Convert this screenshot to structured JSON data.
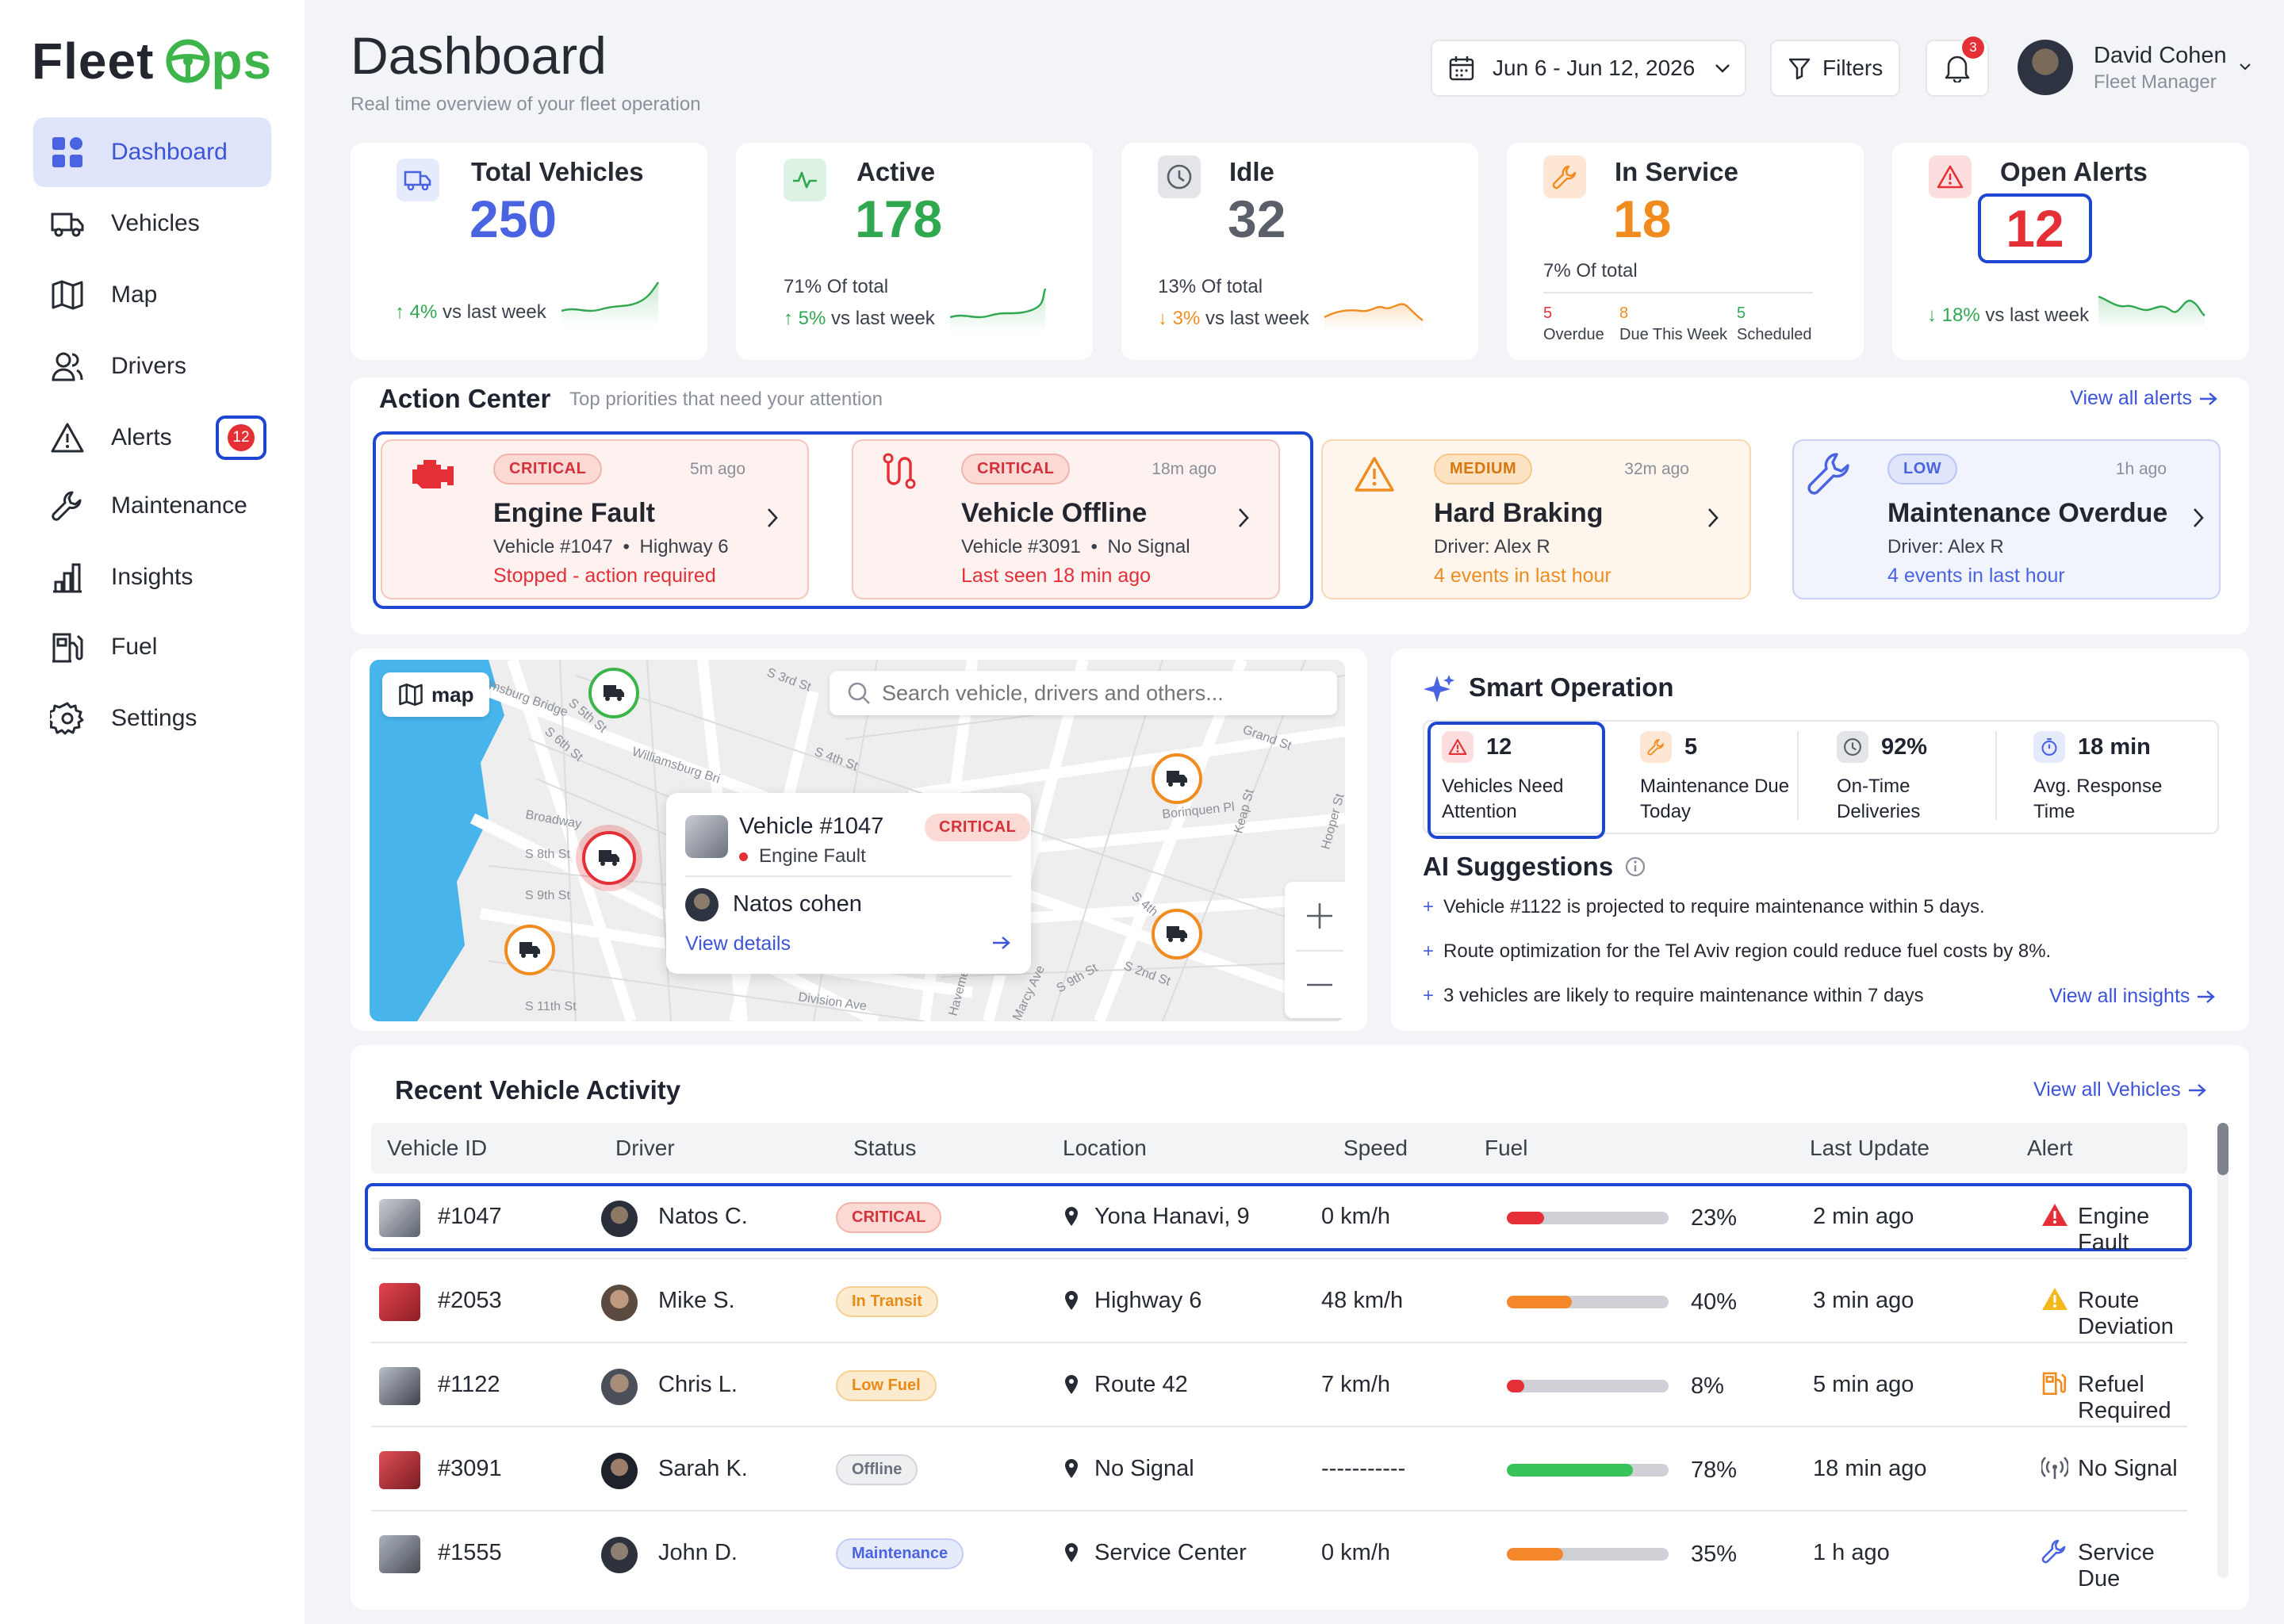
{
  "app": {
    "logo_prefix": "Fleet",
    "logo_suffix": "ps"
  },
  "sidebar": {
    "items": [
      {
        "label": "Dashboard",
        "icon": "grid-icon",
        "active": true
      },
      {
        "label": "Vehicles",
        "icon": "truck-icon"
      },
      {
        "label": "Map",
        "icon": "map-icon"
      },
      {
        "label": "Drivers",
        "icon": "users-icon"
      },
      {
        "label": "Alerts",
        "icon": "alert-icon",
        "badge": "12"
      },
      {
        "label": "Maintenance",
        "icon": "wrench-icon"
      },
      {
        "label": "Insights",
        "icon": "bar-chart-icon"
      },
      {
        "label": "Fuel",
        "icon": "fuel-icon"
      },
      {
        "label": "Settings",
        "icon": "gear-icon"
      }
    ]
  },
  "header": {
    "title": "Dashboard",
    "subtitle": "Real time overview of your fleet operation",
    "date_range": "Jun 6 - Jun 12,  2026",
    "filters_label": "Filters",
    "notif_count": "3",
    "user_name": "David Cohen",
    "user_role": "Fleet Manager"
  },
  "kpis": {
    "total": {
      "label": "Total Vehicles",
      "value": "250",
      "trend": "4%",
      "trend_text": "vs last week",
      "color": "#4a63e0"
    },
    "active": {
      "label": "Active",
      "value": "178",
      "pct": "71% Of total",
      "trend": "5%",
      "trend_text": "vs last week",
      "color": "#2fa84f"
    },
    "idle": {
      "label": "Idle",
      "value": "32",
      "pct": "13% Of total",
      "trend": "3%",
      "trend_text": "vs last week",
      "color": "#5a5f6a"
    },
    "service": {
      "label": "In Service",
      "value": "18",
      "pct": "7% Of total",
      "color": "#f08c1f",
      "breakdown": [
        {
          "num": "5",
          "label": "Overdue",
          "color": "#e52f37"
        },
        {
          "num": "8",
          "label": "Due This Week",
          "color": "#f08c1f"
        },
        {
          "num": "5",
          "label": "Scheduled",
          "color": "#2fa84f"
        }
      ]
    },
    "alerts": {
      "label": "Open Alerts",
      "value": "12",
      "trend": "18%",
      "trend_text": "vs last week",
      "color": "#e52f37"
    }
  },
  "action_center": {
    "title": "Action Center",
    "subtitle": "Top priorities that need your attention",
    "view_all": "View all alerts",
    "cards": [
      {
        "severity": "CRITICAL",
        "time": "5m ago",
        "title": "Engine Fault",
        "line1": "Vehicle #1047",
        "line1b": "Highway 6",
        "line2": "Stopped - action required",
        "icon": "engine-icon"
      },
      {
        "severity": "CRITICAL",
        "time": "18m ago",
        "title": "Vehicle Offline",
        "line1": "Vehicle #3091",
        "line1b": "No Signal",
        "line2": "Last seen 18 min ago",
        "icon": "route-icon"
      },
      {
        "severity": "MEDIUM",
        "time": "32m ago",
        "title": "Hard Braking",
        "line1": "Driver: Alex R",
        "line2": "4 events in last hour",
        "icon": "warning-icon"
      },
      {
        "severity": "LOW",
        "time": "1h ago",
        "title": "Maintenance Overdue",
        "line1": "Driver: Alex R",
        "line2": "4 events in last hour",
        "icon": "wrench-icon"
      }
    ]
  },
  "map": {
    "chip_label": "map",
    "search_placeholder": "Search vehicle, drivers and others...",
    "streets": [
      "msburg Bridge",
      "S 5th St",
      "S 6th St",
      "Williamsburg Bri",
      "Broadway",
      "S 8th St",
      "S 9th St",
      "S 11th St",
      "S 4th St",
      "S 3rd St",
      "Grand St",
      "Borinquen Pl",
      "Division Ave",
      "Havemeyer St",
      "Keap St",
      "Hooper St",
      "S 9th St",
      "Marcy Ave",
      "S 4th St",
      "S 2nd St"
    ],
    "popup": {
      "vehicle": "Vehicle #1047",
      "severity": "CRITICAL",
      "issue": "Engine Fault",
      "driver": "Natos cohen",
      "link": "View details"
    }
  },
  "smart": {
    "title": "Smart Operation",
    "stats": [
      {
        "value": "12",
        "label": "Vehicles Need Attention"
      },
      {
        "value": "5",
        "label": "Maintenance Due Today"
      },
      {
        "value": "92%",
        "label": "On-Time Deliveries"
      },
      {
        "value": "18 min",
        "label": "Avg. Response Time"
      }
    ],
    "ai_title": "AI Suggestions",
    "suggestions": [
      "Vehicle #1122 is projected to require maintenance within 5 days.",
      "Route optimization for the Tel Aviv region could reduce fuel costs by 8%.",
      "3 vehicles are likely to require maintenance within 7 days"
    ],
    "view_all": "View all insights"
  },
  "activity": {
    "title": "Recent Vehicle Activity",
    "view_all": "View all Vehicles",
    "columns": [
      "Vehicle ID",
      "Driver",
      "Status",
      "Location",
      "Speed",
      "Fuel",
      "Last Update",
      "Alert"
    ],
    "rows": [
      {
        "id": "#1047",
        "driver": "Natos C.",
        "status": "CRITICAL",
        "location": "Yona Hanavi, 9",
        "speed": "0 km/h",
        "fuel": 23,
        "fuel_label": "23%",
        "fuel_color": "#e52f37",
        "update": "2 min ago",
        "alert": "Engine Fault",
        "alert_icon": "alert-triangle-icon"
      },
      {
        "id": "#2053",
        "driver": "Mike S.",
        "status": "In Transit",
        "location": "Highway 6",
        "speed": "48 km/h",
        "fuel": 40,
        "fuel_label": "40%",
        "fuel_color": "#f5872b",
        "update": "3 min ago",
        "alert": "Route Deviation",
        "alert_icon": "warning-icon"
      },
      {
        "id": "#1122",
        "driver": "Chris L.",
        "status": "Low Fuel",
        "location": "Route 42",
        "speed": "7 km/h",
        "fuel": 8,
        "fuel_label": "8%",
        "fuel_color": "#e52f37",
        "update": "5 min ago",
        "alert": "Refuel Required",
        "alert_icon": "fuel-icon"
      },
      {
        "id": "#3091",
        "driver": "Sarah K.",
        "status": "Offline",
        "location": "No Signal",
        "speed": "-----------",
        "fuel": 78,
        "fuel_label": "78%",
        "fuel_color": "#38c25a",
        "update": "18 min ago",
        "alert": "No Signal",
        "alert_icon": "signal-icon"
      },
      {
        "id": "#1555",
        "driver": "John D.",
        "status": "Maintenance",
        "location": "Service Center",
        "speed": "0 km/h",
        "fuel": 35,
        "fuel_label": "35%",
        "fuel_color": "#f5872b",
        "update": "1 h ago",
        "alert": "Service Due",
        "alert_icon": "wrench-icon"
      }
    ]
  }
}
